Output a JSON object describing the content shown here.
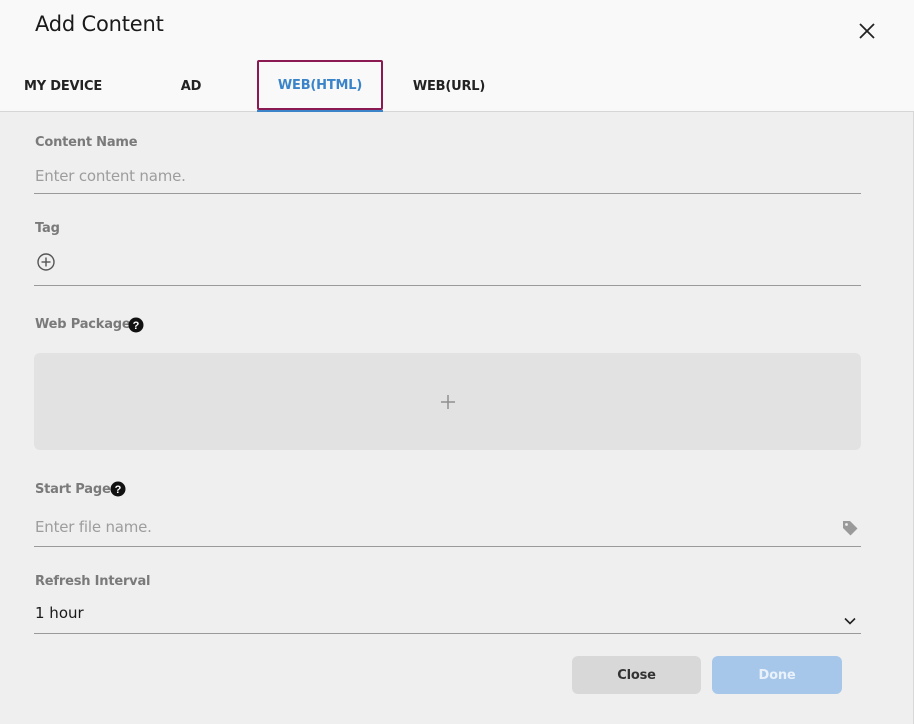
{
  "dialog": {
    "title": "Add Content"
  },
  "tabs": [
    {
      "label": "MY DEVICE"
    },
    {
      "label": "AD"
    },
    {
      "label": "WEB(HTML)",
      "selected": true
    },
    {
      "label": "WEB(URL)"
    }
  ],
  "form": {
    "content_name": {
      "label": "Content Name",
      "placeholder": "Enter content name.",
      "value": ""
    },
    "tag": {
      "label": "Tag",
      "icon": "add-circle-icon"
    },
    "web_package": {
      "label": "Web Package",
      "help_icon": "question-circle-icon",
      "dropzone_icon": "plus-icon"
    },
    "start_page": {
      "label": "Start Page",
      "help_icon": "question-circle-icon",
      "placeholder": "Enter file name.",
      "value": "",
      "trailing_icon": "tag-icon"
    },
    "refresh_interval": {
      "label": "Refresh Interval",
      "value": "1 hour",
      "trailing_icon": "chevron-down-icon"
    }
  },
  "buttons": {
    "close_label": "Close",
    "done_label": "Done",
    "done_enabled": false
  },
  "colors": {
    "accent": "#3b84c9",
    "selected_tab_outline": "#8b1a52",
    "done_disabled_bg": "#a7c7ea",
    "close_bg": "#d8d8d8",
    "panel_bg": "#efefef"
  }
}
